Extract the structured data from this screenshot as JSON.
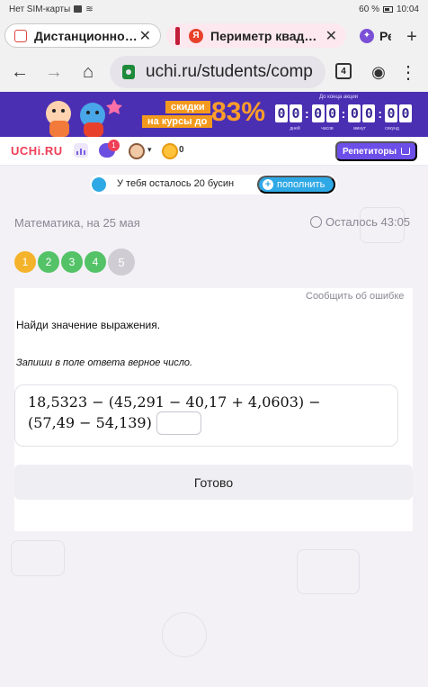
{
  "statusbar": {
    "carrier": "Нет SIM-карты",
    "battery": "60 %",
    "time": "10:04"
  },
  "tabs": [
    {
      "label": "Дистанционно…",
      "active": true
    },
    {
      "label": "Периметр квад…",
      "active": false
    },
    {
      "label": "Реш",
      "active": false
    }
  ],
  "toolbar": {
    "url": "uchi.ru/students/comp",
    "tab_count": "4"
  },
  "promo": {
    "line1": "скидки",
    "line2": "на курсы до",
    "percent": "83%",
    "countdown_title": "До конца акции",
    "digits": [
      "0",
      "0",
      "0",
      "0",
      "0",
      "0",
      "0",
      "0"
    ],
    "units": [
      "дней",
      "часов",
      "минут",
      "секунд"
    ],
    "colors": {
      "background": "#4a2fb3",
      "accent": "#ff9d2a"
    }
  },
  "header": {
    "logo": "UCHi.RU",
    "chat_badge": "1",
    "coins": "0",
    "tutors_label": "Репетиторы"
  },
  "beads": {
    "text": "У тебя осталось 20 бусин",
    "topup_label": "пополнить"
  },
  "lesson": {
    "subject": "Математика, на 25 мая",
    "timer": "Осталось 43:05"
  },
  "steps": [
    {
      "label": "1",
      "state": "current"
    },
    {
      "label": "2",
      "state": "done"
    },
    {
      "label": "3",
      "state": "done"
    },
    {
      "label": "4",
      "state": "done"
    },
    {
      "label": "5",
      "state": "todo"
    }
  ],
  "task": {
    "report_label": "Сообщить об ошибке",
    "question": "Найди значение выражения.",
    "hint": "Запиши в поле ответа верное число.",
    "expression_line1": "18,5323 − (45,291 − 40,17 + 4,0603) −",
    "expression_line2": "(57,49 − 54,139) =",
    "answer_value": "",
    "submit_label": "Готово"
  }
}
